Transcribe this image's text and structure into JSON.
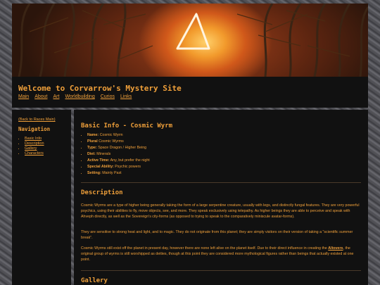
{
  "header": {
    "title": "Welcome to Corvarrow's Mystery Site",
    "nav": [
      "Main",
      "About",
      "Art",
      "Worldbuilding",
      "Curios",
      "Links"
    ]
  },
  "sidebar": {
    "back_link": "(Back to Races Main)",
    "heading": "Navigation",
    "items": [
      "Basic Info",
      "Description",
      "Gallery",
      "Characters"
    ]
  },
  "basic_info": {
    "title": "Basic Info - Cosmic Wyrm",
    "rows": [
      {
        "label": "Name:",
        "value": "Cosmic Wyrm"
      },
      {
        "label": "Plural",
        "value": "Cosmic Wyrms"
      },
      {
        "label": "Type:",
        "value": "Space Dragon / Higher Being"
      },
      {
        "label": "Diet:",
        "value": "Minerals"
      },
      {
        "label": "Active Time:",
        "value": "Any, but prefer the night"
      },
      {
        "label": "Special Ability:",
        "value": "Psychic powers"
      },
      {
        "label": "Setting:",
        "value": "Mainly Past"
      }
    ]
  },
  "description": {
    "title": "Description",
    "p1": "Cosmic Wyrms are a type of higher being generally taking the form of a large serpentine creature, usually with legs, and distinctly fungal features. They are very powerful psychics, using their abilities to fly, move objects, see, and more. They speak exclusively using telepathy. As higher beings they are able to perceive and speak with Ahveph directly, as well as the Sovereign's city-forms (as opposed to trying to speak to the comparatively miniscule avatar-forms).",
    "p2": "They are sensitive to strong heat and light, and to magic. They do not originate from this planet; they are simply visitors on their version of taking a \"scientific summer break\".",
    "p3_before": "Cosmic Wyrms still exist off the planet in present day, however there are none left alive on the planet itself. Due to their direct influence in creating the ",
    "p3_link": "Altovers",
    "p3_after": ", the original group of wyrms is still worshipped as deities, though at this point they are considered more mythological figures rather than beings that actually existed at one point."
  },
  "gallery": {
    "title": "Gallery"
  },
  "colors": {
    "accent": "#f0a03a",
    "panel": "#111111"
  }
}
